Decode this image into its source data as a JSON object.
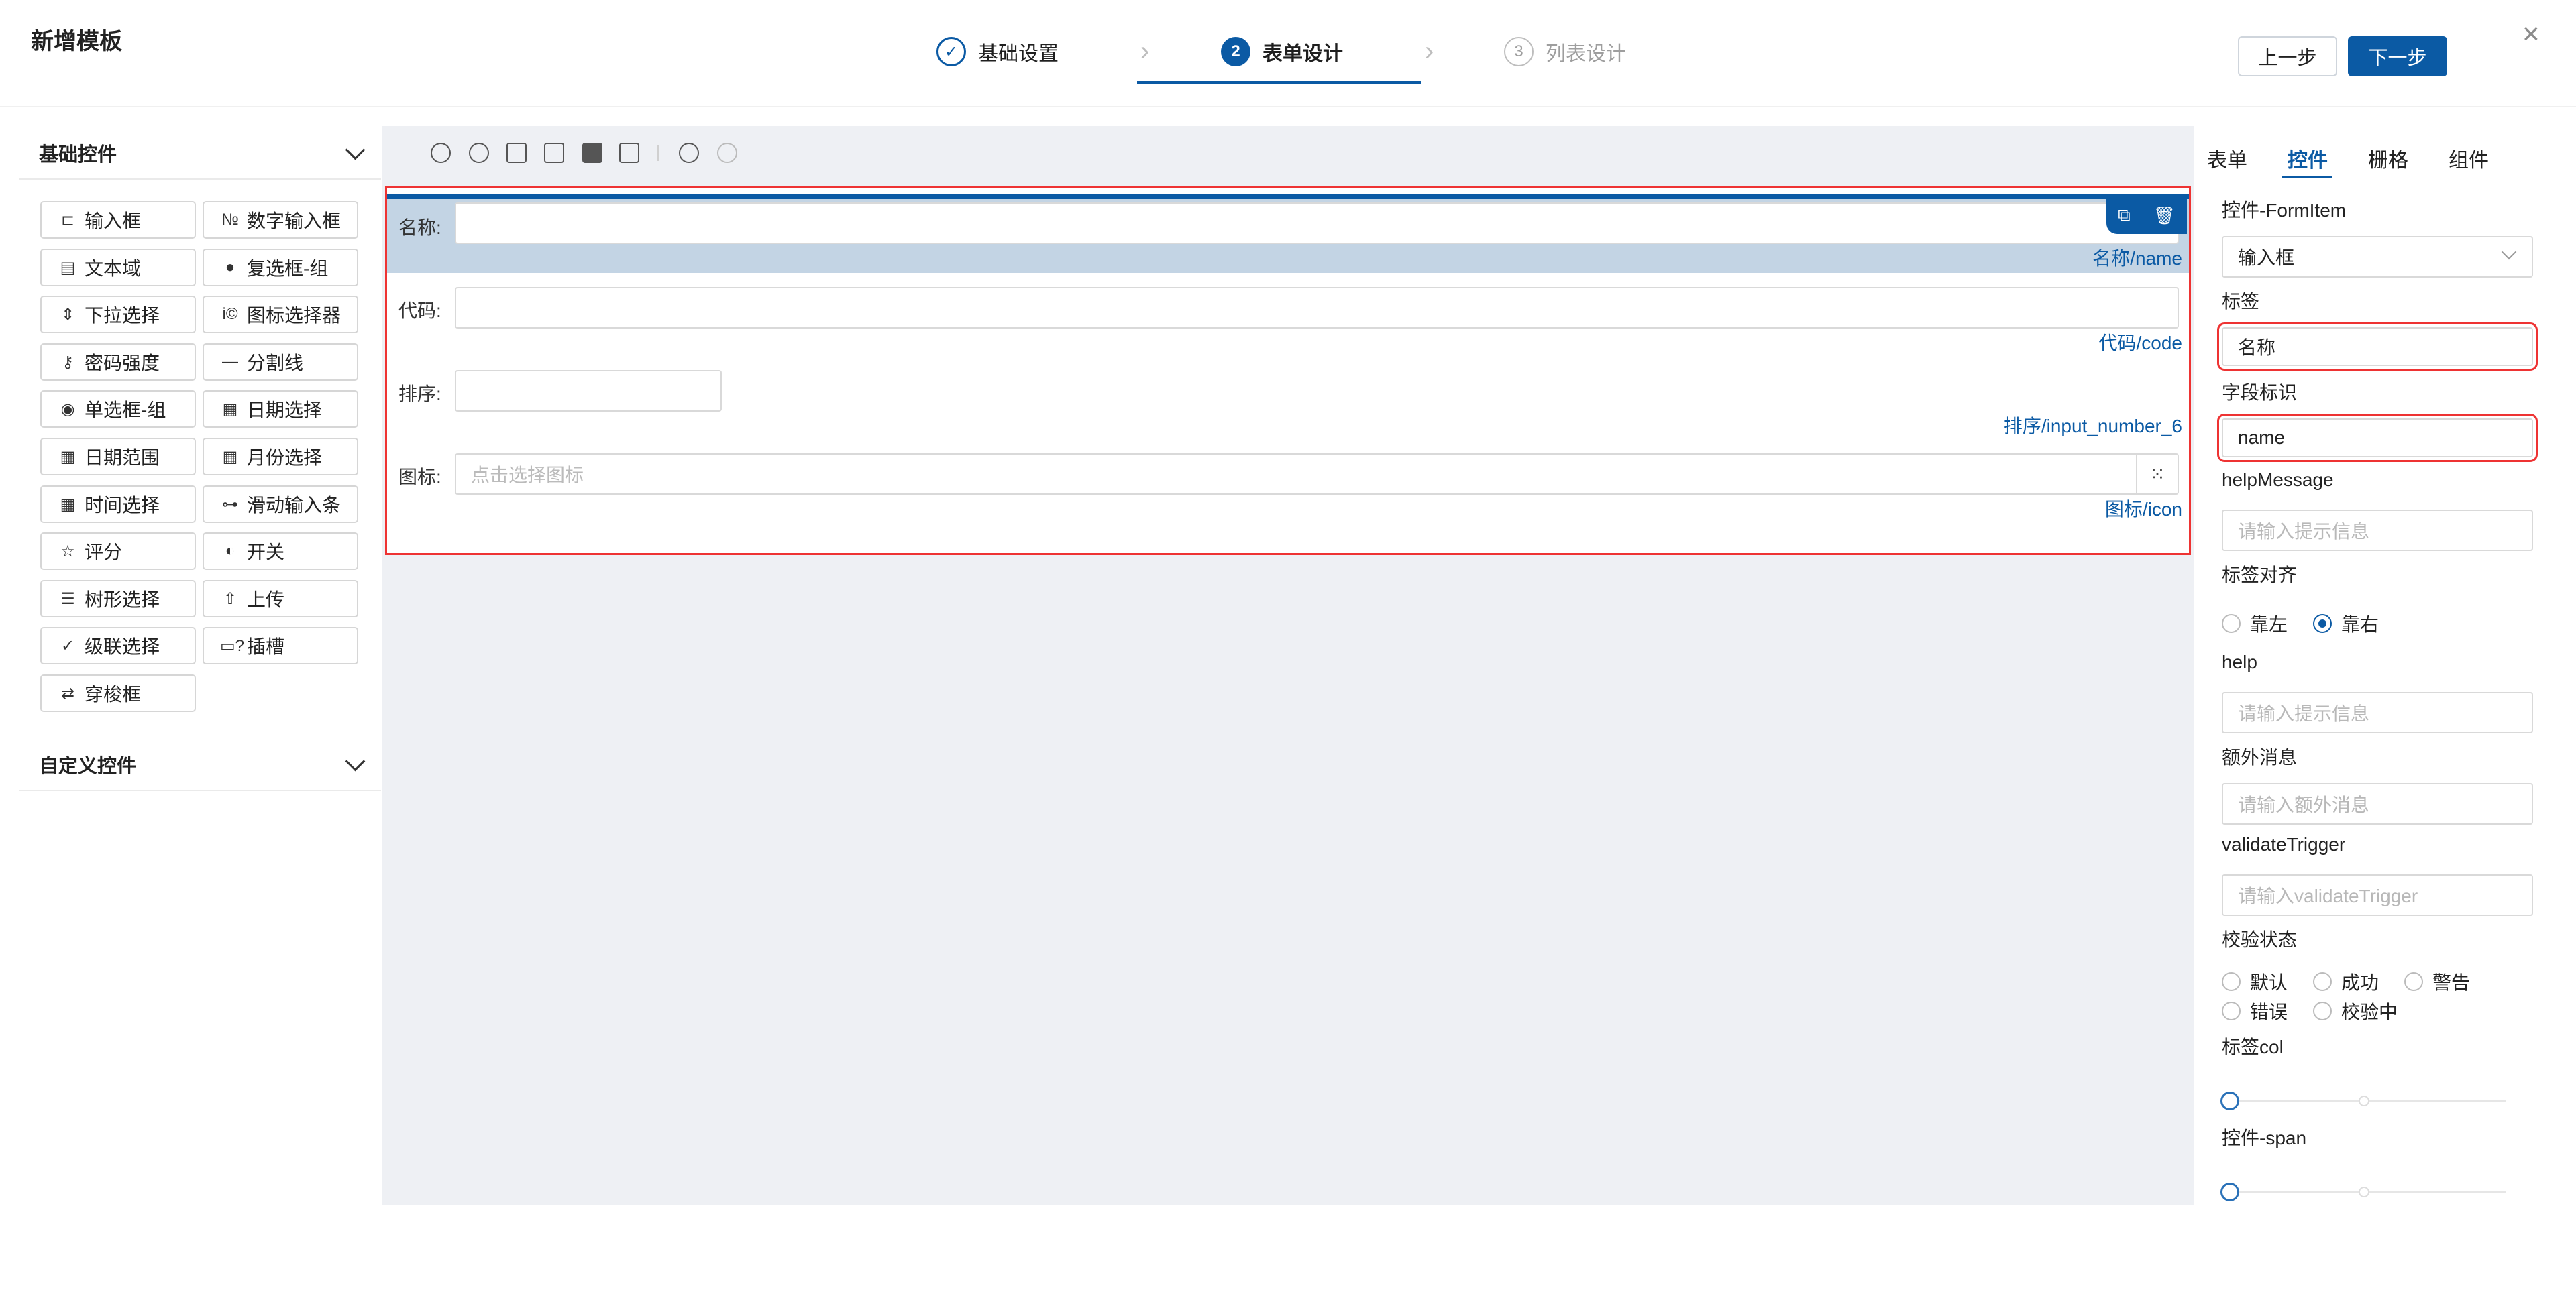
{
  "modal": {
    "title": "新增模板",
    "close_icon": "×"
  },
  "steps": [
    {
      "index": "✓",
      "label": "基础设置",
      "state": "done"
    },
    {
      "index": "2",
      "label": "表单设计",
      "state": "active"
    },
    {
      "index": "3",
      "label": "列表设计",
      "state": "wait"
    }
  ],
  "header_buttons": {
    "prev": "上一步",
    "next": "下一步"
  },
  "left_panel": {
    "basic_title": "基础控件",
    "custom_title": "自定义控件",
    "controls": [
      {
        "icon": "⊏",
        "label": "输入框"
      },
      {
        "icon": "№",
        "label": "数字输入框"
      },
      {
        "icon": "▤",
        "label": "文本域"
      },
      {
        "icon": "●",
        "label": "复选框-组"
      },
      {
        "icon": "⇕",
        "label": "下拉选择"
      },
      {
        "icon": "i©",
        "label": "图标选择器"
      },
      {
        "icon": "⚷",
        "label": "密码强度"
      },
      {
        "icon": "—",
        "label": "分割线"
      },
      {
        "icon": "◉",
        "label": "单选框-组"
      },
      {
        "icon": "▦",
        "label": "日期选择"
      },
      {
        "icon": "▦",
        "label": "日期范围"
      },
      {
        "icon": "▦",
        "label": "月份选择"
      },
      {
        "icon": "▦",
        "label": "时间选择"
      },
      {
        "icon": "⊶",
        "label": "滑动输入条"
      },
      {
        "icon": "☆",
        "label": "评分"
      },
      {
        "icon": "◐",
        "label": "开关"
      },
      {
        "icon": "☰",
        "label": "树形选择"
      },
      {
        "icon": "⇧",
        "label": "上传"
      },
      {
        "icon": "✓",
        "label": "级联选择"
      },
      {
        "icon": "▭?",
        "label": "插槽"
      },
      {
        "icon": "⇄",
        "label": "穿梭框"
      }
    ]
  },
  "form": {
    "fields": [
      {
        "label": "名称:",
        "key": "名称/name",
        "placeholder": ""
      },
      {
        "label": "代码:",
        "key": "代码/code",
        "placeholder": ""
      },
      {
        "label": "排序:",
        "key": "排序/input_number_6",
        "placeholder": ""
      },
      {
        "label": "图标:",
        "key": "图标/icon",
        "placeholder": "点击选择图标"
      }
    ]
  },
  "right_panel": {
    "tabs": [
      "表单",
      "控件",
      "栅格",
      "组件"
    ],
    "control_formitem_label": "控件-FormItem",
    "control_type_value": "输入框",
    "label_title": "标签",
    "label_value": "名称",
    "field_id_title": "字段标识",
    "field_id_value": "name",
    "help_message_title": "helpMessage",
    "help_message_placeholder": "请输入提示信息",
    "label_align_title": "标签对齐",
    "label_align_options": [
      "靠左",
      "靠右"
    ],
    "label_align_selected": "靠右",
    "help_title": "help",
    "help_placeholder": "请输入提示信息",
    "extra_title": "额外消息",
    "extra_placeholder": "请输入额外消息",
    "validate_trigger_title": "validateTrigger",
    "validate_trigger_placeholder": "请输入validateTrigger",
    "validate_status_title": "校验状态",
    "validate_status_options": [
      "默认",
      "成功",
      "警告",
      "错误",
      "校验中"
    ],
    "label_col_title": "标签col",
    "label_col_value": 0,
    "control_span_title": "控件-span",
    "control_span_value": 0
  },
  "colors": {
    "primary": "#0b5aa4",
    "highlight": "#e33333",
    "canvas_bg": "#eef0f4",
    "selected_row": "#c3d4e4"
  }
}
